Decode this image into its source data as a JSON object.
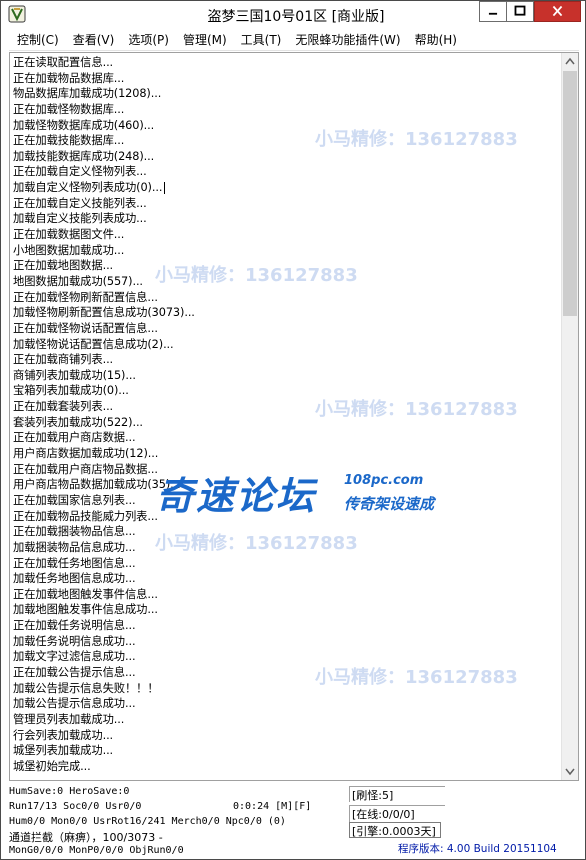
{
  "window": {
    "title": "盗梦三国10号01区 [商业版]"
  },
  "menu": [
    "控制(C)",
    "查看(V)",
    "选项(P)",
    "管理(M)",
    "工具(T)",
    "无限蜂功能插件(W)",
    "帮助(H)"
  ],
  "log": [
    "正在读取配置信息...",
    "正在加载物品数据库...",
    "物品数据库加载成功(1208)...",
    "正在加载怪物数据库...",
    "加载怪物数据库成功(460)...",
    "正在加载技能数据库...",
    "加载技能数据库成功(248)...",
    "正在加载自定义怪物列表...",
    "加载自定义怪物列表成功(0)...",
    "正在加载自定义技能列表...",
    "加载自定义技能列表成功...",
    "正在加载数据图文件...",
    "小地图数据加载成功...",
    "正在加载地图数据...",
    "地图数据加载成功(557)...",
    "正在加载怪物刷新配置信息...",
    "加载怪物刷新配置信息成功(3073)...",
    "正在加载怪物说话配置信息...",
    "加载怪物说话配置信息成功(2)...",
    "正在加载商铺列表...",
    "商铺列表加载成功(15)...",
    "宝箱列表加载成功(0)...",
    "正在加载套装列表...",
    "套装列表加载成功(522)...",
    "正在加载用户商店数据...",
    "用户商店数据加载成功(12)...",
    "正在加载用户商店物品数据...",
    "用户商店物品数据加载成功(35)...",
    "正在加载国家信息列表...",
    "正在加载物品技能威力列表...",
    "正在加载捆装物品信息...",
    "加载捆装物品信息成功...",
    "正在加载任务地图信息...",
    "加载任务地图信息成功...",
    "正在加载地图触发事件信息...",
    "加载地图触发事件信息成功...",
    "正在加载任务说明信息...",
    "加载任务说明信息成功...",
    "加载文字过滤信息成功...",
    "正在加载公告提示信息...",
    "加载公告提示信息失败！！！",
    "加载公告提示信息成功...",
    "管理员列表加载成功...",
    "行会列表加载成功...",
    "城堡列表加载成功...",
    "城堡初始完成..."
  ],
  "watermark": {
    "text": "小马精修：136127883",
    "edge_char": "小"
  },
  "logo": {
    "main": "奇速论坛",
    "url": "108pc.com",
    "tagline": "传奇架设速成"
  },
  "status": {
    "hum": "HumSave:0 HeroSave:0",
    "run": "Run17/13 Soc0/0 Usr0/0",
    "time": "0:0:24 [M][F]",
    "mon": "Hum0/0 Mon0/0 UsrRot16/241 Merch0/0 Npc0/0 (0)",
    "block": "通道拦截（麻痹），100/3073 -",
    "cut": "MonG0/0/0 MonP0/0/0 ObjRun0/0",
    "refresh": "[刷怪:5]",
    "online": "[在线:0/0/0]",
    "engine": "[引擎:0.0003天]",
    "version": "程序版本: 4.00 Build 20151104"
  }
}
